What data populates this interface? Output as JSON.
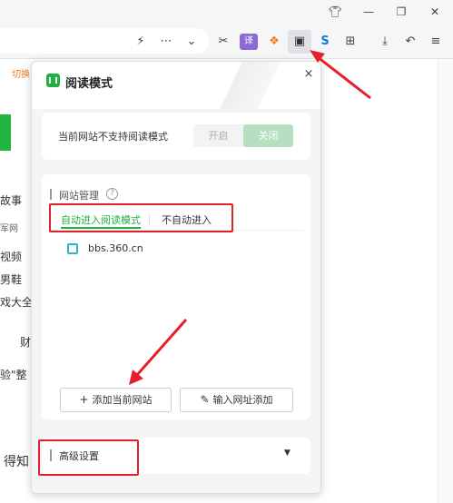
{
  "window": {
    "tshirt_icon": "tshirt-icon",
    "minimize_icon": "minimize-icon",
    "restore_icon": "restore-icon",
    "close_icon": "close-icon"
  },
  "toolbar": {
    "icons": [
      "flash-icon",
      "more-icon",
      "chevron-down-icon",
      "scissors-icon",
      "translate-icon",
      "game-icon",
      "reading-mode-icon",
      "shield-icon",
      "apps-grid-icon",
      "download-icon",
      "undo-icon",
      "menu-icon"
    ]
  },
  "page": {
    "left_fragments": [
      "切换",
      "故事",
      "军网",
      "视频",
      "男鞋",
      "戏大全",
      "财",
      "验\"整",
      "得知"
    ]
  },
  "popup": {
    "title": "阅读模式",
    "close_label": "×",
    "status_text": "当前网站不支持阅读模式",
    "toggle_on": "开启",
    "toggle_off": "关闭",
    "site_management_label": "网站管理",
    "help_symbol": "?",
    "tabs": [
      "自动进入阅读模式",
      "不自动进入"
    ],
    "sites": [
      "bbs.360.cn"
    ],
    "add_current_button": "添加当前网站",
    "add_current_icon_glyph": "+",
    "add_url_button": "输入网址添加",
    "add_url_icon_glyph": "✎",
    "advanced_settings_label": "高级设置",
    "advanced_caret": "▼"
  },
  "colors": {
    "accent_green": "#20b144",
    "annotation_red": "#e4212a"
  }
}
